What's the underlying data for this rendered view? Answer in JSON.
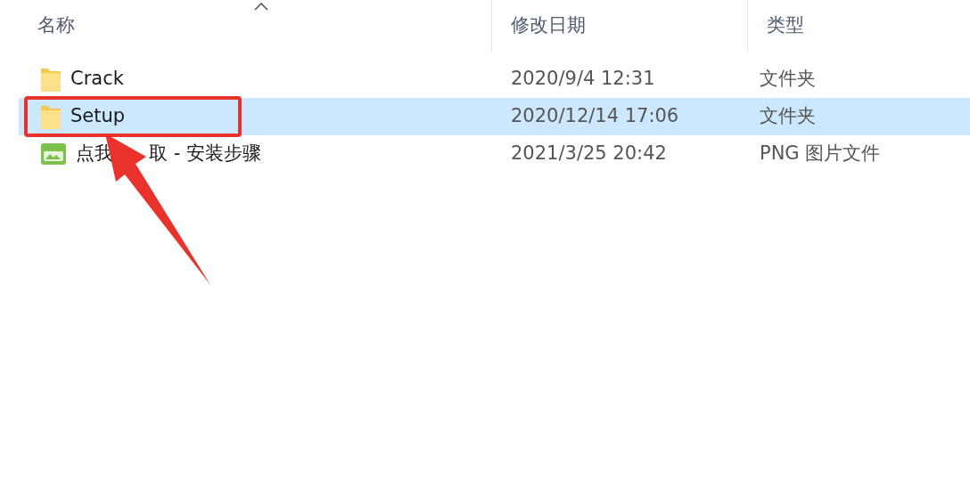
{
  "columns": [
    "名称",
    "修改日期",
    "类型"
  ],
  "rows": [
    {
      "kind": "folder",
      "name": "Crack",
      "date": "2020/9/4 12:31",
      "type": "文件夹",
      "selected": false,
      "highlighted": false
    },
    {
      "kind": "folder",
      "name": "Setup",
      "date": "2020/12/14 17:06",
      "type": "文件夹",
      "selected": true,
      "highlighted": true
    },
    {
      "kind": "image",
      "name": "点我",
      "name_after_arrow": "取 - 安装步骤",
      "date": "2021/3/25 20:42",
      "type": "PNG 图片文件",
      "selected": false,
      "highlighted": false
    }
  ]
}
